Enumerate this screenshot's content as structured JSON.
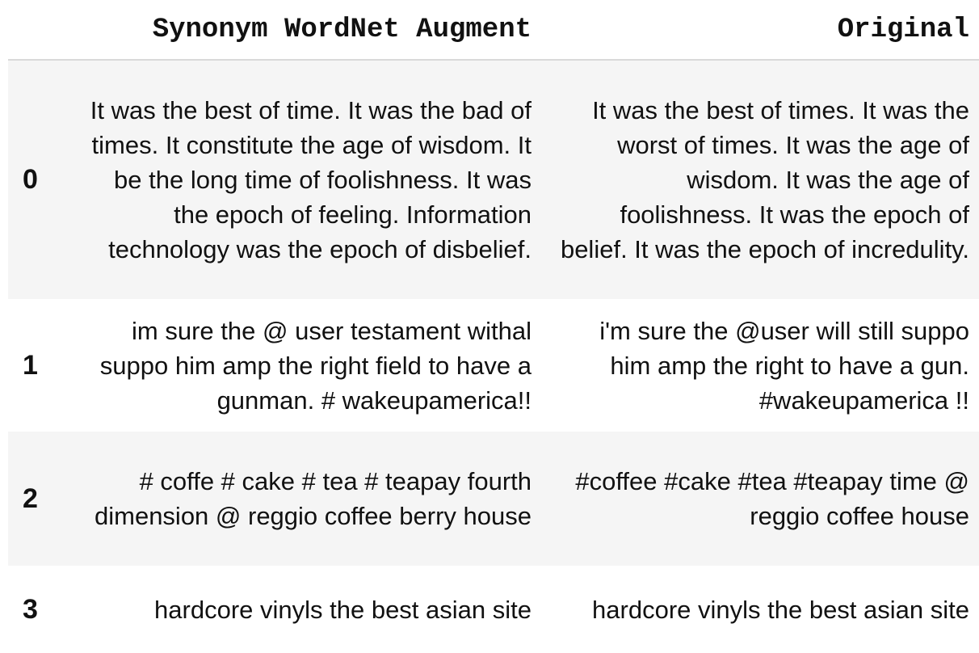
{
  "table": {
    "headers": [
      "",
      "Synonym WordNet Augment",
      "Original"
    ],
    "rows": [
      {
        "index": "0",
        "augment": "It was the best of time. It was the bad of times. It constitute the age of wisdom. It be the long time of foolishness. It was the epoch of feeling. Information technology was the epoch of disbelief.",
        "original": "It was the best of times. It was the worst of times. It was the age of wisdom. It was the age of foolishness. It was the epoch of belief. It was the epoch of incredulity."
      },
      {
        "index": "1",
        "augment": "im sure the @ user testament withal suppo him amp the right field to have a gunman. # wakeupamerica!!",
        "original": "i'm sure the @user will still suppo him amp the right to have a gun. #wakeupamerica !!"
      },
      {
        "index": "2",
        "augment": "# coffe # cake # tea # teapay fourth dimension @ reggio coffee berry house",
        "original": "#coffee #cake #tea #teapay time @ reggio coffee house"
      },
      {
        "index": "3",
        "augment": "hardcore vinyls the best asian site",
        "original": "hardcore vinyls the best asian site"
      }
    ]
  }
}
